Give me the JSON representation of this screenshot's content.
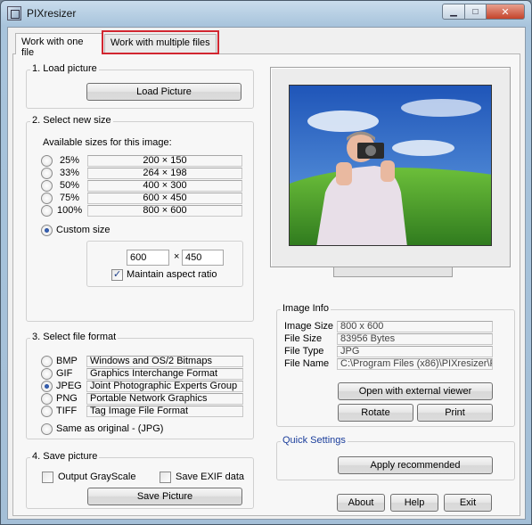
{
  "window": {
    "title": "PIXresizer"
  },
  "tabs": [
    {
      "label": "Work with one file"
    },
    {
      "label": "Work with multiple files"
    }
  ],
  "load": {
    "title": "1. Load picture",
    "button": "Load Picture"
  },
  "size": {
    "title": "2. Select new size",
    "available_label": "Available sizes for this image:",
    "options": [
      {
        "pct": "25%",
        "dims": "200 × 150"
      },
      {
        "pct": "33%",
        "dims": "264 × 198"
      },
      {
        "pct": "50%",
        "dims": "400 × 300"
      },
      {
        "pct": "75%",
        "dims": "600 × 450"
      },
      {
        "pct": "100%",
        "dims": "800 × 600"
      }
    ],
    "custom_label": "Custom size",
    "custom_width": "600",
    "times": "×",
    "custom_height": "450",
    "maintain_label": "Maintain aspect ratio"
  },
  "format": {
    "title": "3. Select file format",
    "options": [
      {
        "code": "BMP",
        "desc": "Windows and OS/2 Bitmaps"
      },
      {
        "code": "GIF",
        "desc": "Graphics Interchange Format"
      },
      {
        "code": "JPEG",
        "desc": "Joint Photographic Experts Group"
      },
      {
        "code": "PNG",
        "desc": "Portable Network Graphics"
      },
      {
        "code": "TIFF",
        "desc": "Tag Image File Format"
      }
    ],
    "same_label": "Same as original  - (JPG)"
  },
  "save": {
    "title": "4. Save picture",
    "grayscale_label": "Output GrayScale",
    "exif_label": "Save EXIF data",
    "button": "Save Picture"
  },
  "info": {
    "title": "Image Info",
    "rows": [
      {
        "label": "Image Size",
        "value": "800 x 600"
      },
      {
        "label": "File Size",
        "value": "83956 Bytes"
      },
      {
        "label": "File Type",
        "value": "JPG"
      },
      {
        "label": "File Name",
        "value": "C:\\Program Files (x86)\\PIXresizer\\PI"
      }
    ],
    "open_button": "Open with external viewer",
    "rotate_button": "Rotate",
    "print_button": "Print"
  },
  "quick": {
    "title": "Quick Settings",
    "apply_button": "Apply recommended"
  },
  "bottom": {
    "about": "About",
    "help": "Help",
    "exit": "Exit"
  },
  "colors": {
    "accent_highlight": "#d22630",
    "group_title_blue": "#1a3d9b",
    "sky": "#2f6cc9",
    "grass": "#4f9a2f"
  }
}
